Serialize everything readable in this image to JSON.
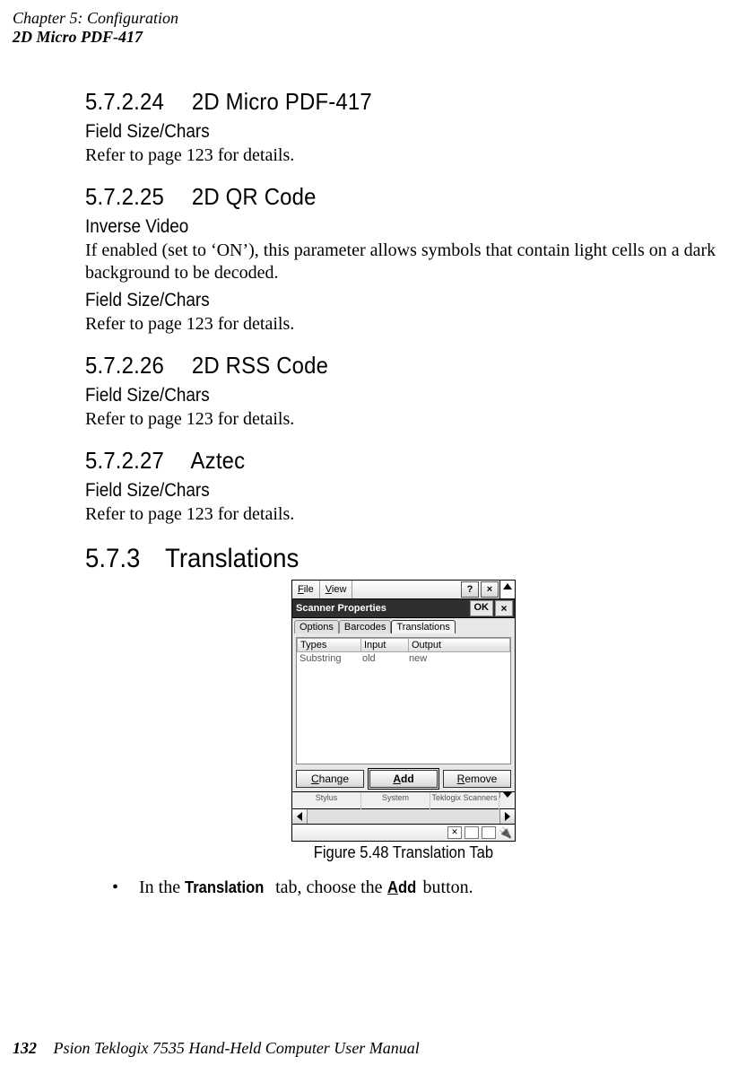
{
  "header": {
    "line1": "Chapter 5: Configuration",
    "line2": "2D Micro PDF-417"
  },
  "sections": {
    "s1": {
      "heading": "5.7.2.24  2D Micro PDF-417",
      "sub1": "Field Size/Chars",
      "body1": "Refer to page 123 for details."
    },
    "s2": {
      "heading": "5.7.2.25  2D QR Code",
      "sub1": "Inverse Video",
      "body1": "If enabled (set to ‘ON’), this parameter allows symbols that contain light cells on a dark background to be decoded.",
      "sub2": "Field Size/Chars",
      "body2": "Refer to page 123 for details."
    },
    "s3": {
      "heading": "5.7.2.26  2D RSS Code",
      "sub1": "Field Size/Chars",
      "body1": "Refer to page 123 for details."
    },
    "s4": {
      "heading": "5.7.2.27  Aztec",
      "sub1": "Field Size/Chars",
      "body1": "Refer to page 123 for details."
    },
    "s5": {
      "heading": "5.7.3 Translations"
    }
  },
  "figure": {
    "caption": "Figure 5.48 Translation Tab",
    "menubar_file": "File",
    "menubar_view": "View",
    "help_btn": "?",
    "close_btn": "×",
    "titlebar": "Scanner Properties",
    "ok": "OK",
    "tabs": {
      "a": "Options",
      "b": "Barcodes",
      "c": "Translations"
    },
    "cols": {
      "a": "Types",
      "b": "Input",
      "c": "Output"
    },
    "row": {
      "a": "Substring",
      "b": "old",
      "c": "new"
    },
    "btns": {
      "change": "Change",
      "add_rest": "dd",
      "remove": "Remove"
    },
    "iconlabels": {
      "a": "Stylus",
      "b": "System",
      "c": "Teklogix Scanners"
    }
  },
  "bullet": {
    "pre": "In the ",
    "bold1": "Translation",
    "mid": " tab, choose the ",
    "bold2_rest": "dd",
    "post": " button."
  },
  "footer": {
    "page": "132",
    "text": "Psion Teklogix 7535 Hand-Held Computer User Manual"
  }
}
